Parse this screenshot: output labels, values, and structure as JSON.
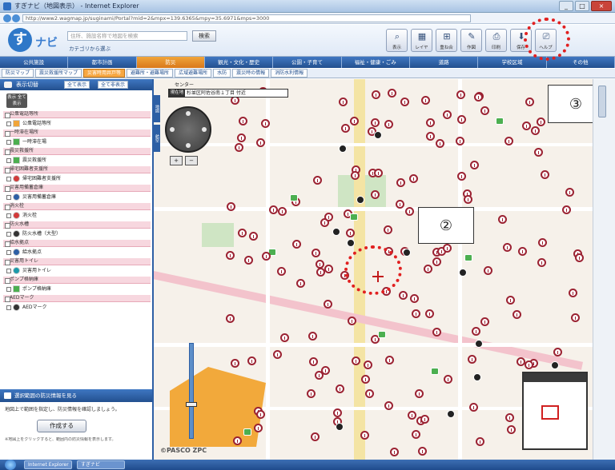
{
  "window": {
    "title": "すぎナビ（地図表示） - Internet Explorer",
    "url": "http://www2.wagmap.jp/suginami/Portal?mid=2&mpx=139.6365&mpy=35.6971&mps=3000"
  },
  "header": {
    "logo_mark": "す",
    "logo_sub": "ナビ",
    "search_placeholder": "住所、施設名称で地図を検索",
    "search_button": "検索",
    "search_option": "カテゴリから選ぶ",
    "tools": [
      {
        "glyph": "⌕",
        "label": "表示"
      },
      {
        "glyph": "▦",
        "label": "レイヤ"
      },
      {
        "glyph": "⊞",
        "label": "重ね合"
      },
      {
        "glyph": "✎",
        "label": "作図"
      },
      {
        "glyph": "⎙",
        "label": "印刷"
      },
      {
        "glyph": "⬇",
        "label": "保存"
      },
      {
        "glyph": "⎚",
        "label": "ヘルプ"
      }
    ]
  },
  "tabs": [
    "公共施設",
    "都市計画",
    "防災",
    "観光・文化・歴史",
    "公園・子育て",
    "福祉・健康・ごみ",
    "道路",
    "学校区域",
    "その他"
  ],
  "subtabs": [
    "防災マップ",
    "震災救援所マップ",
    "災害時用井戸等",
    "避難所・避難場所",
    "広域避難場所",
    "水防",
    "震災時の情報",
    "消防水利情報"
  ],
  "left_panel": {
    "head": "表示切替",
    "btn_all_show": "全て表示",
    "btn_all_hide": "全て非表示",
    "toggle_all": "表示 全て表示",
    "categories": [
      {
        "head": "公衆電話等所",
        "item": "公衆電話等所",
        "color": "#f0a53a"
      },
      {
        "head": "一時滞在場所",
        "item": "一時滞在場",
        "color": "#4caf50"
      },
      {
        "head": "震災救援所",
        "item": "震災救援所",
        "color": "#4caf50"
      },
      {
        "head": "帰宅困難者支援所",
        "item": "帰宅困難者支援所",
        "color": "#d23a3a"
      },
      {
        "head": "災害用備蓄倉庫",
        "item": "災害用備蓄倉庫",
        "color": "#2d5fa5"
      },
      {
        "head": "消火栓",
        "item": "消火栓",
        "color": "#d23a3a"
      },
      {
        "head": "防火水槽",
        "item": "防火水槽（大型）",
        "color": "#333333"
      },
      {
        "head": "給水拠点",
        "item": "給水拠点",
        "color": "#2d5fa5"
      },
      {
        "head": "災害用トイレ",
        "item": "災害用トイレ",
        "color": "#1b9aaa"
      },
      {
        "head": "ポンプ格納庫",
        "item": "ポンプ格納庫",
        "color": "#4caf50"
      },
      {
        "head": "AEDマーク",
        "item": "AEDマーク",
        "color": "#333333"
      }
    ],
    "bottom_head": "選択範囲の防災情報を見る",
    "bottom_text": "地図上で範囲を指定し、防災情報を確認しましょう。",
    "create_button": "作成する",
    "bottom_note": "※地図上をクリックすると、範囲内の防災情報を表示します。"
  },
  "map": {
    "center_label": "センター",
    "address_tag": "現在地",
    "address": "杉並区阿佐谷南１丁目 付近",
    "zoom_in": "+",
    "zoom_out": "−",
    "zoom_level_fraction": 0.35,
    "copyright": "©PASCO ZPC",
    "callout_2": "②",
    "callout_3": "③",
    "vtab_1": "地図",
    "vtab_2": "航空"
  },
  "taskbar": {
    "items": [
      "Internet Explorer",
      "すぎナビ"
    ]
  },
  "colors": {
    "primary": "#2d5fa5",
    "accent": "#f0a53a",
    "highlight_circle": "#e12020",
    "pin": "#9b2232"
  }
}
